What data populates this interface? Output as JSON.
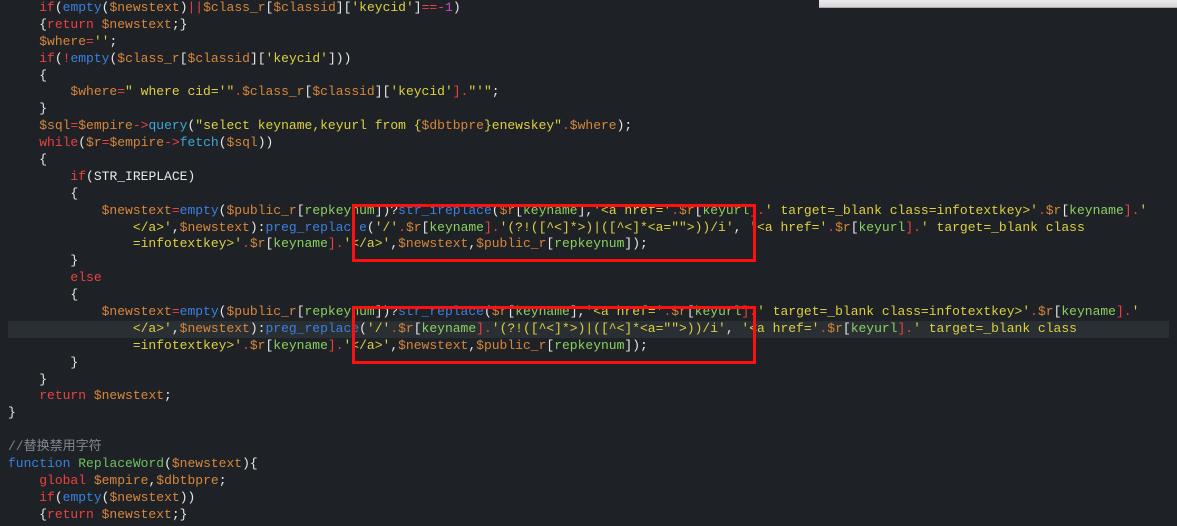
{
  "lines": [
    {
      "segs": [
        {
          "t": "    ",
          "c": "c-white"
        },
        {
          "t": "if",
          "c": "c-red"
        },
        {
          "t": "(",
          "c": "c-white"
        },
        {
          "t": "empty",
          "c": "c-blue"
        },
        {
          "t": "(",
          "c": "c-white"
        },
        {
          "t": "$newstext",
          "c": "c-orange"
        },
        {
          "t": ")",
          "c": "c-white"
        },
        {
          "t": "||",
          "c": "c-red"
        },
        {
          "t": "$class_r",
          "c": "c-orange"
        },
        {
          "t": "[",
          "c": "c-white"
        },
        {
          "t": "$classid",
          "c": "c-orange"
        },
        {
          "t": "][",
          "c": "c-white"
        },
        {
          "t": "'keycid'",
          "c": "c-yellow"
        },
        {
          "t": "]",
          "c": "c-white"
        },
        {
          "t": "==-",
          "c": "c-red"
        },
        {
          "t": "1",
          "c": "c-magenta"
        },
        {
          "t": ")",
          "c": "c-white"
        }
      ]
    },
    {
      "segs": [
        {
          "t": "    {",
          "c": "c-white"
        },
        {
          "t": "return",
          "c": "c-red"
        },
        {
          "t": " $newstext",
          "c": "c-orange"
        },
        {
          "t": ";}",
          "c": "c-white"
        }
      ]
    },
    {
      "segs": [
        {
          "t": "    ",
          "c": "c-white"
        },
        {
          "t": "$where",
          "c": "c-orange"
        },
        {
          "t": "=",
          "c": "c-red"
        },
        {
          "t": "''",
          "c": "c-yellow"
        },
        {
          "t": ";",
          "c": "c-white"
        }
      ]
    },
    {
      "segs": [
        {
          "t": "    ",
          "c": "c-white"
        },
        {
          "t": "if",
          "c": "c-red"
        },
        {
          "t": "(",
          "c": "c-white"
        },
        {
          "t": "!",
          "c": "c-red"
        },
        {
          "t": "empty",
          "c": "c-blue"
        },
        {
          "t": "(",
          "c": "c-white"
        },
        {
          "t": "$class_r",
          "c": "c-orange"
        },
        {
          "t": "[",
          "c": "c-white"
        },
        {
          "t": "$classid",
          "c": "c-orange"
        },
        {
          "t": "][",
          "c": "c-white"
        },
        {
          "t": "'keycid'",
          "c": "c-yellow"
        },
        {
          "t": "]))",
          "c": "c-white"
        }
      ]
    },
    {
      "segs": [
        {
          "t": "    {",
          "c": "c-white"
        }
      ]
    },
    {
      "segs": [
        {
          "t": "        ",
          "c": "c-white"
        },
        {
          "t": "$where",
          "c": "c-orange"
        },
        {
          "t": "=",
          "c": "c-red"
        },
        {
          "t": "\" where cid='\"",
          "c": "c-yellow"
        },
        {
          "t": ".",
          "c": "c-red"
        },
        {
          "t": "$class_r",
          "c": "c-orange"
        },
        {
          "t": "[",
          "c": "c-white"
        },
        {
          "t": "$classid",
          "c": "c-orange"
        },
        {
          "t": "][",
          "c": "c-white"
        },
        {
          "t": "'keycid'",
          "c": "c-yellow"
        },
        {
          "t": "].",
          "c": "c-red"
        },
        {
          "t": "\"'\"",
          "c": "c-yellow"
        },
        {
          "t": ";",
          "c": "c-white"
        }
      ]
    },
    {
      "segs": [
        {
          "t": "    }",
          "c": "c-white"
        }
      ]
    },
    {
      "segs": [
        {
          "t": "    ",
          "c": "c-white"
        },
        {
          "t": "$sql",
          "c": "c-orange"
        },
        {
          "t": "=",
          "c": "c-red"
        },
        {
          "t": "$empire",
          "c": "c-orange"
        },
        {
          "t": "->",
          "c": "c-red"
        },
        {
          "t": "query",
          "c": "c-cyan"
        },
        {
          "t": "(",
          "c": "c-white"
        },
        {
          "t": "\"select keyname,keyurl from {",
          "c": "c-yellow"
        },
        {
          "t": "$dbtbpre",
          "c": "c-orange"
        },
        {
          "t": "}enewskey\"",
          "c": "c-yellow"
        },
        {
          "t": ".",
          "c": "c-red"
        },
        {
          "t": "$where",
          "c": "c-orange"
        },
        {
          "t": ");",
          "c": "c-white"
        }
      ]
    },
    {
      "segs": [
        {
          "t": "    ",
          "c": "c-white"
        },
        {
          "t": "while",
          "c": "c-red"
        },
        {
          "t": "(",
          "c": "c-white"
        },
        {
          "t": "$r",
          "c": "c-orange"
        },
        {
          "t": "=",
          "c": "c-red"
        },
        {
          "t": "$empire",
          "c": "c-orange"
        },
        {
          "t": "->",
          "c": "c-red"
        },
        {
          "t": "fetch",
          "c": "c-cyan"
        },
        {
          "t": "(",
          "c": "c-white"
        },
        {
          "t": "$sql",
          "c": "c-orange"
        },
        {
          "t": "))",
          "c": "c-white"
        }
      ]
    },
    {
      "segs": [
        {
          "t": "    {",
          "c": "c-white"
        }
      ]
    },
    {
      "segs": [
        {
          "t": "        ",
          "c": "c-white"
        },
        {
          "t": "if",
          "c": "c-red"
        },
        {
          "t": "(",
          "c": "c-white"
        },
        {
          "t": "STR_IREPLACE",
          "c": "c-white"
        },
        {
          "t": ")",
          "c": "c-white"
        }
      ]
    },
    {
      "segs": [
        {
          "t": "        {",
          "c": "c-white"
        }
      ]
    },
    {
      "segs": [
        {
          "t": "            ",
          "c": "c-white"
        },
        {
          "t": "$newstext",
          "c": "c-orange"
        },
        {
          "t": "=",
          "c": "c-red"
        },
        {
          "t": "empty",
          "c": "c-blue"
        },
        {
          "t": "(",
          "c": "c-white"
        },
        {
          "t": "$public_r",
          "c": "c-orange"
        },
        {
          "t": "[",
          "c": "c-white"
        },
        {
          "t": "repkeynum",
          "c": "c-ltgreen"
        },
        {
          "t": "])?",
          "c": "c-white"
        },
        {
          "t": "str_ireplace",
          "c": "c-blue"
        },
        {
          "t": "(",
          "c": "c-white"
        },
        {
          "t": "$r",
          "c": "c-orange"
        },
        {
          "t": "[",
          "c": "c-white"
        },
        {
          "t": "keyname",
          "c": "c-ltgreen"
        },
        {
          "t": "],",
          "c": "c-white"
        },
        {
          "t": "'<a href='",
          "c": "c-yellow"
        },
        {
          "t": ".",
          "c": "c-red"
        },
        {
          "t": "$r",
          "c": "c-orange"
        },
        {
          "t": "[",
          "c": "c-white"
        },
        {
          "t": "keyurl",
          "c": "c-ltgreen"
        },
        {
          "t": "].",
          "c": "c-red"
        },
        {
          "t": "' target=_blank class=infotextkey>'",
          "c": "c-yellow"
        },
        {
          "t": ".",
          "c": "c-red"
        },
        {
          "t": "$r",
          "c": "c-orange"
        },
        {
          "t": "[",
          "c": "c-white"
        },
        {
          "t": "keyname",
          "c": "c-ltgreen"
        },
        {
          "t": "].",
          "c": "c-red"
        },
        {
          "t": "'",
          "c": "c-yellow"
        }
      ]
    },
    {
      "segs": [
        {
          "t": "                </a>'",
          "c": "c-yellow"
        },
        {
          "t": ",",
          "c": "c-white"
        },
        {
          "t": "$newstext",
          "c": "c-orange"
        },
        {
          "t": "):",
          "c": "c-white"
        },
        {
          "t": "preg_replac",
          "c": "c-blue"
        },
        {
          "t": " e",
          "c": "c-blue"
        },
        {
          "t": "(",
          "c": "c-white"
        },
        {
          "t": "'/'",
          "c": "c-yellow"
        },
        {
          "t": ".",
          "c": "c-red"
        },
        {
          "t": "$r",
          "c": "c-orange"
        },
        {
          "t": "[",
          "c": "c-white"
        },
        {
          "t": "keyname",
          "c": "c-ltgreen"
        },
        {
          "t": "].",
          "c": "c-red"
        },
        {
          "t": "'(?!([^<]*>)|([^<]*<a=\"\">))/i'",
          "c": "c-yellow"
        },
        {
          "t": ",",
          "c": "c-white"
        },
        {
          "t": " '",
          "c": "c-yellow"
        },
        {
          "t": "<a href='",
          "c": "c-yellow"
        },
        {
          "t": ".",
          "c": "c-red"
        },
        {
          "t": "$r",
          "c": "c-orange"
        },
        {
          "t": "[",
          "c": "c-white"
        },
        {
          "t": "keyurl",
          "c": "c-ltgreen"
        },
        {
          "t": "].",
          "c": "c-red"
        },
        {
          "t": "' target=_blank class",
          "c": "c-yellow"
        }
      ]
    },
    {
      "segs": [
        {
          "t": "                =infotextkey>'",
          "c": "c-yellow"
        },
        {
          "t": ".",
          "c": "c-red"
        },
        {
          "t": "$r",
          "c": "c-orange"
        },
        {
          "t": "[",
          "c": "c-white"
        },
        {
          "t": "keyname",
          "c": "c-ltgreen"
        },
        {
          "t": "].",
          "c": "c-red"
        },
        {
          "t": "'</a>'",
          "c": "c-yellow"
        },
        {
          "t": ",",
          "c": "c-white"
        },
        {
          "t": "$newstext",
          "c": "c-orange"
        },
        {
          "t": ",",
          "c": "c-white"
        },
        {
          "t": "$public_r",
          "c": "c-orange"
        },
        {
          "t": "[",
          "c": "c-white"
        },
        {
          "t": "repkeynum",
          "c": "c-ltgreen"
        },
        {
          "t": "]);",
          "c": "c-white"
        }
      ]
    },
    {
      "segs": [
        {
          "t": "        }",
          "c": "c-white"
        }
      ]
    },
    {
      "segs": [
        {
          "t": "        ",
          "c": "c-white"
        },
        {
          "t": "else",
          "c": "c-red"
        }
      ]
    },
    {
      "segs": [
        {
          "t": "        {",
          "c": "c-white"
        }
      ]
    },
    {
      "segs": [
        {
          "t": "            ",
          "c": "c-white"
        },
        {
          "t": "$newstext",
          "c": "c-orange"
        },
        {
          "t": "=",
          "c": "c-red"
        },
        {
          "t": "empty",
          "c": "c-blue"
        },
        {
          "t": "(",
          "c": "c-white"
        },
        {
          "t": "$public_r",
          "c": "c-orange"
        },
        {
          "t": "[",
          "c": "c-white"
        },
        {
          "t": "repkeynum",
          "c": "c-ltgreen"
        },
        {
          "t": "])?",
          "c": "c-white"
        },
        {
          "t": "str_replace",
          "c": "c-blue"
        },
        {
          "t": "(",
          "c": "c-white"
        },
        {
          "t": "$r",
          "c": "c-orange"
        },
        {
          "t": "[",
          "c": "c-white"
        },
        {
          "t": "keyname",
          "c": "c-ltgreen"
        },
        {
          "t": "],",
          "c": "c-white"
        },
        {
          "t": "'<a href='",
          "c": "c-yellow"
        },
        {
          "t": ".",
          "c": "c-red"
        },
        {
          "t": "$r",
          "c": "c-orange"
        },
        {
          "t": "[",
          "c": "c-white"
        },
        {
          "t": "keyurl",
          "c": "c-ltgreen"
        },
        {
          "t": "].",
          "c": "c-red"
        },
        {
          "t": "' target=_blank class=infotextkey>'",
          "c": "c-yellow"
        },
        {
          "t": ".",
          "c": "c-red"
        },
        {
          "t": "$r",
          "c": "c-orange"
        },
        {
          "t": "[",
          "c": "c-white"
        },
        {
          "t": "keyname",
          "c": "c-ltgreen"
        },
        {
          "t": "].",
          "c": "c-red"
        },
        {
          "t": "'",
          "c": "c-yellow"
        }
      ]
    },
    {
      "segs": [
        {
          "t": "                </a>'",
          "c": "c-yellow"
        },
        {
          "t": ",",
          "c": "c-white"
        },
        {
          "t": "$newstext",
          "c": "c-orange"
        },
        {
          "t": "):",
          "c": "c-white"
        },
        {
          "t": "preg_replace",
          "c": "c-blue"
        },
        {
          "t": "(",
          "c": "c-white"
        },
        {
          "t": "'/'",
          "c": "c-yellow"
        },
        {
          "t": ".",
          "c": "c-red"
        },
        {
          "t": "$r",
          "c": "c-orange"
        },
        {
          "t": "[",
          "c": "c-white"
        },
        {
          "t": "keyname",
          "c": "c-ltgreen"
        },
        {
          "t": "].",
          "c": "c-red"
        },
        {
          "t": "'(?!([^<]*>)|([^<]*<a=\"\">))/i'",
          "c": "c-yellow"
        },
        {
          "t": ",",
          "c": "c-white"
        },
        {
          "t": " '",
          "c": "c-yellow"
        },
        {
          "t": "<a href='",
          "c": "c-yellow"
        },
        {
          "t": ".",
          "c": "c-red"
        },
        {
          "t": "$r",
          "c": "c-orange"
        },
        {
          "t": "[",
          "c": "c-white"
        },
        {
          "t": "keyurl",
          "c": "c-ltgreen"
        },
        {
          "t": "].",
          "c": "c-red"
        },
        {
          "t": "' target=_blank class",
          "c": "c-yellow"
        }
      ],
      "hl": true
    },
    {
      "segs": [
        {
          "t": "                =infotextkey>'",
          "c": "c-yellow"
        },
        {
          "t": ".",
          "c": "c-red"
        },
        {
          "t": "$r",
          "c": "c-orange"
        },
        {
          "t": "[",
          "c": "c-white"
        },
        {
          "t": "keyname",
          "c": "c-ltgreen"
        },
        {
          "t": "].",
          "c": "c-red"
        },
        {
          "t": "'</a>'",
          "c": "c-yellow"
        },
        {
          "t": ",",
          "c": "c-white"
        },
        {
          "t": "$newstext",
          "c": "c-orange"
        },
        {
          "t": ",",
          "c": "c-white"
        },
        {
          "t": "$public_r",
          "c": "c-orange"
        },
        {
          "t": "[",
          "c": "c-white"
        },
        {
          "t": "repkeynum",
          "c": "c-ltgreen"
        },
        {
          "t": "]);",
          "c": "c-white"
        }
      ]
    },
    {
      "segs": [
        {
          "t": "        }",
          "c": "c-white"
        }
      ]
    },
    {
      "segs": [
        {
          "t": "    }",
          "c": "c-white"
        }
      ]
    },
    {
      "segs": [
        {
          "t": "    ",
          "c": "c-white"
        },
        {
          "t": "return",
          "c": "c-red"
        },
        {
          "t": " $newstext",
          "c": "c-orange"
        },
        {
          "t": ";",
          "c": "c-white"
        }
      ]
    },
    {
      "segs": [
        {
          "t": "}",
          "c": "c-white"
        }
      ]
    },
    {
      "segs": [
        {
          "t": " ",
          "c": "c-white"
        }
      ]
    },
    {
      "segs": [
        {
          "t": "//替换禁用字符",
          "c": "c-grey"
        }
      ]
    },
    {
      "segs": [
        {
          "t": "function",
          "c": "c-blue"
        },
        {
          "t": " ",
          "c": "c-white"
        },
        {
          "t": "ReplaceWord",
          "c": "c-green"
        },
        {
          "t": "(",
          "c": "c-white"
        },
        {
          "t": "$newstext",
          "c": "c-orange"
        },
        {
          "t": "){",
          "c": "c-white"
        }
      ]
    },
    {
      "segs": [
        {
          "t": "    ",
          "c": "c-white"
        },
        {
          "t": "global",
          "c": "c-red"
        },
        {
          "t": " $empire",
          "c": "c-orange"
        },
        {
          "t": ",",
          "c": "c-white"
        },
        {
          "t": "$dbtbpre",
          "c": "c-orange"
        },
        {
          "t": ";",
          "c": "c-white"
        }
      ]
    },
    {
      "segs": [
        {
          "t": "    ",
          "c": "c-white"
        },
        {
          "t": "if",
          "c": "c-red"
        },
        {
          "t": "(",
          "c": "c-white"
        },
        {
          "t": "empty",
          "c": "c-blue"
        },
        {
          "t": "(",
          "c": "c-white"
        },
        {
          "t": "$newstext",
          "c": "c-orange"
        },
        {
          "t": "))",
          "c": "c-white"
        }
      ]
    },
    {
      "segs": [
        {
          "t": "    {",
          "c": "c-white"
        },
        {
          "t": "return",
          "c": "c-red"
        },
        {
          "t": " $newstext",
          "c": "c-orange"
        },
        {
          "t": ";}",
          "c": "c-white"
        }
      ]
    }
  ]
}
